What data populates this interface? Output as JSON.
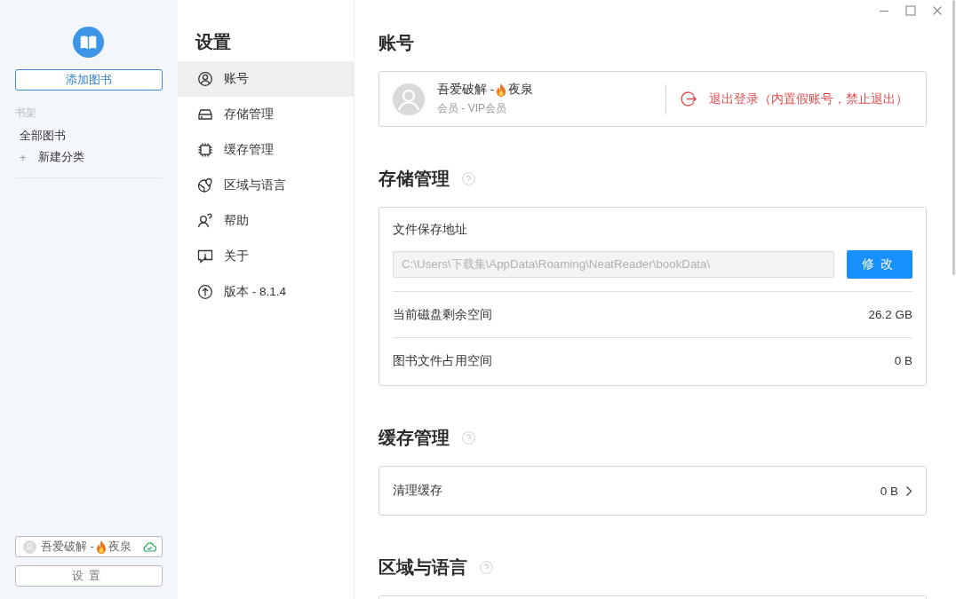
{
  "sidebar": {
    "add_button": "添加图书",
    "section_label": "书架",
    "items": [
      {
        "kind": "link",
        "label": "全部图书"
      },
      {
        "kind": "add",
        "icon": "+",
        "label": "新建分类"
      }
    ],
    "user": {
      "name_prefix": "吾爱破解 -",
      "name_suffix": "夜泉"
    },
    "settings_button": "设置"
  },
  "nav": {
    "title": "设置",
    "items": [
      {
        "label": "账号",
        "selected": true
      },
      {
        "label": "存储管理",
        "selected": false
      },
      {
        "label": "缓存管理",
        "selected": false
      },
      {
        "label": "区域与语言",
        "selected": false
      },
      {
        "label": "帮助",
        "selected": false
      },
      {
        "label": "关于",
        "selected": false
      },
      {
        "label": "版本 - 8.1.4",
        "selected": false
      }
    ]
  },
  "account": {
    "title": "账号",
    "name_prefix": "吾爱破解 -",
    "name_suffix": "夜泉",
    "membership": "会员 - VIP会员",
    "logout": "退出登录（内置假账号，禁止退出）"
  },
  "storage": {
    "title": "存储管理",
    "path_label": "文件保存地址",
    "path_value": "C:\\Users\\下载集\\AppData\\Roaming\\NeatReader\\bookData\\",
    "change_button": "修改",
    "rows": [
      {
        "label": "当前磁盘剩余空间",
        "value": "26.2 GB"
      },
      {
        "label": "图书文件占用空间",
        "value": "0 B"
      }
    ]
  },
  "cache": {
    "title": "缓存管理",
    "rows": [
      {
        "label": "清理缓存",
        "value": "0 B"
      }
    ]
  },
  "region": {
    "title": "区域与语言"
  }
}
